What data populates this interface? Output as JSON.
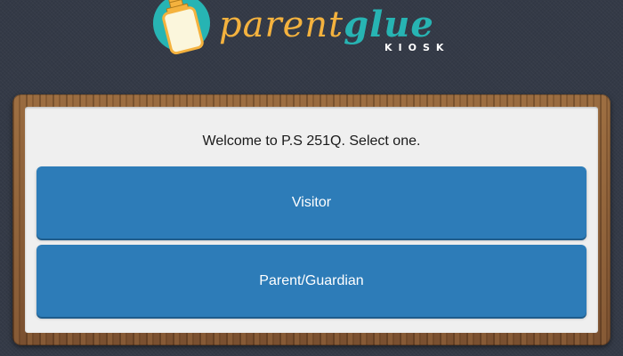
{
  "logo": {
    "word_parent": "parent",
    "word_glue": "glue",
    "subtitle": "KIOSK",
    "icon": "glue-bottle-icon"
  },
  "main": {
    "welcome_text": "Welcome to P.S 251Q. Select one.",
    "buttons": [
      {
        "label": "Visitor"
      },
      {
        "label": "Parent/Guardian"
      }
    ]
  },
  "colors": {
    "background": "#343a47",
    "brand_orange": "#f4b23e",
    "brand_teal": "#27b4b3",
    "button_blue": "#2d7cb8",
    "panel": "#efefef",
    "wood": "#8a6038"
  }
}
